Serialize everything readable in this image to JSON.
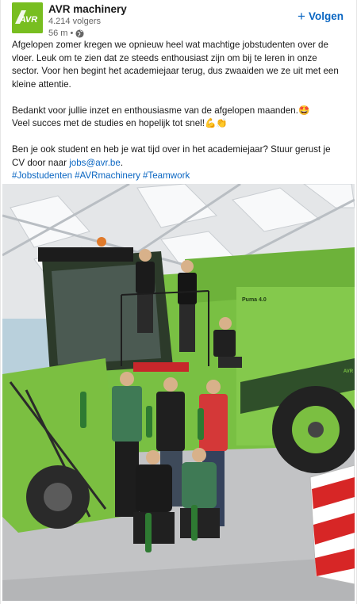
{
  "author": {
    "name": "AVR machinery",
    "followers": "4.214 volgers",
    "time": "56 m",
    "separator": "•",
    "logo_text": "AVR"
  },
  "follow_button": {
    "icon": "+",
    "label": "Volgen"
  },
  "post": {
    "paragraph1": "Afgelopen zomer kregen we opnieuw heel wat machtige jobstudenten over de vloer. Leuk om te zien dat ze steeds enthousiast zijn om bij te leren in onze sector. Voor hen begint het academiejaar terug, dus zwaaiden we ze uit met een kleine attentie.",
    "paragraph2_line1": "Bedankt voor jullie inzet en enthousiasme van de afgelopen maanden.🤩",
    "paragraph2_line2": "Veel succes met de studies en hopelijk tot snel!💪👏",
    "paragraph3_text": "Ben je ook student en heb je wat tijd over in het academiejaar? Stuur gerust je CV door naar ",
    "email": "jobs@avr.be",
    "paragraph3_end": ".",
    "hashtags": [
      "#Jobstudenten",
      "#AVRmachinery",
      "#Teamwork"
    ]
  },
  "photo": {
    "machine_label": "Puma 4.0",
    "machine_brand": "AVR"
  },
  "colors": {
    "brand_green": "#78be20",
    "link_blue": "#0a66c2",
    "machine_green": "#79c043"
  }
}
